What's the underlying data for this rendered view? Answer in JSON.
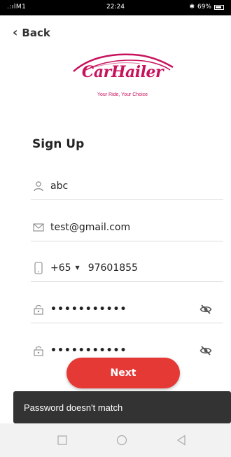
{
  "status_bar": {
    "carrier": ".:ılM1",
    "time": "22:24",
    "battery": "69%",
    "bt_icon": "bluetooth-icon"
  },
  "nav": {
    "back_label": "Back"
  },
  "brand": {
    "name": "CarHailer",
    "tagline": "Your Ride, Your Choice",
    "accent": "#c7125d"
  },
  "form": {
    "title": "Sign Up",
    "username": "abc",
    "email": "test@gmail.com",
    "country_code": "+65",
    "phone": "97601855",
    "password": "•••••••••••",
    "confirm_password": "•••••••••••"
  },
  "button": {
    "next_label": "Next",
    "color": "#e53935"
  },
  "toast": {
    "message": "Password doesn't match"
  }
}
